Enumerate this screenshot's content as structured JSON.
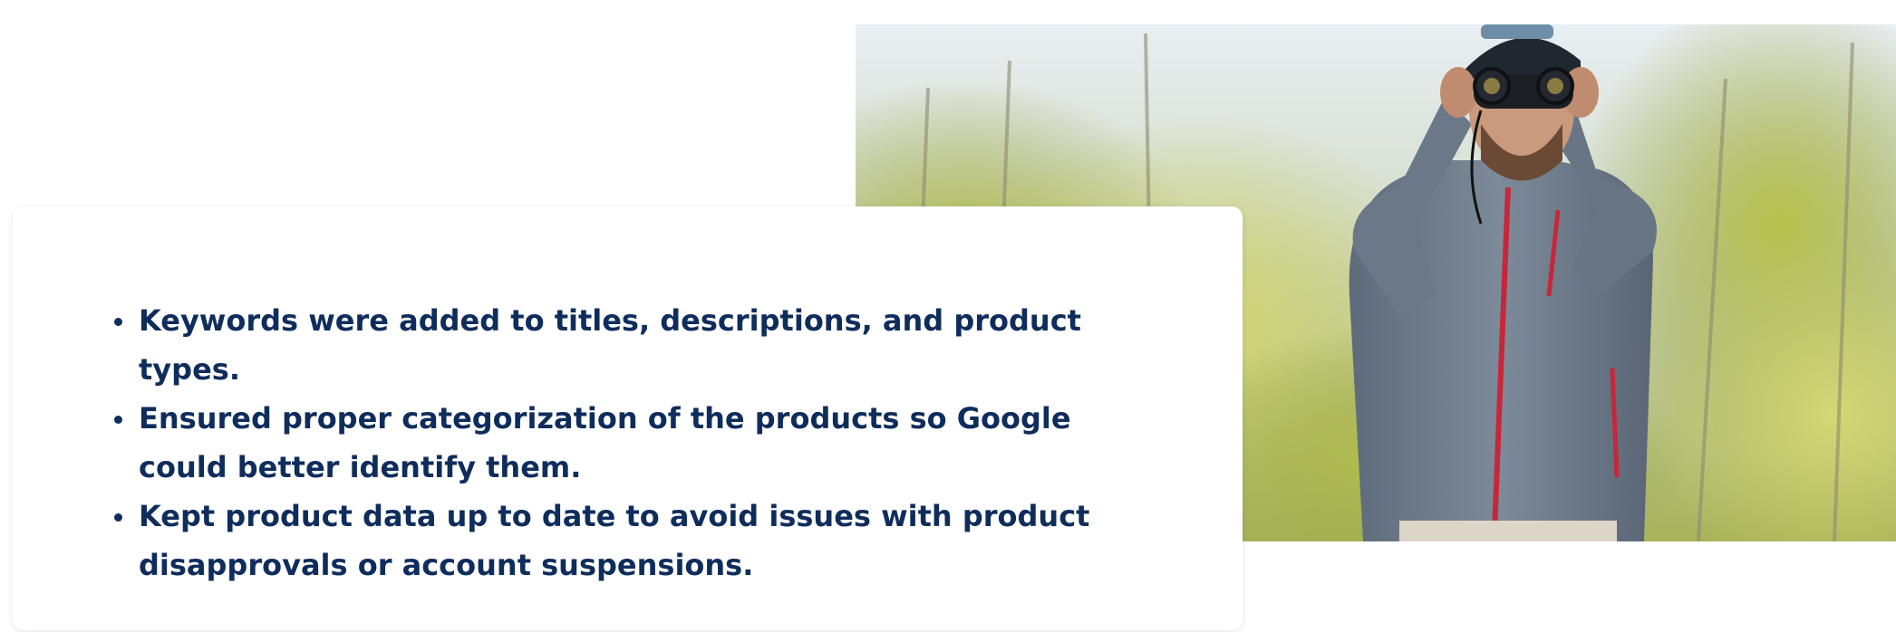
{
  "content": {
    "bullets": [
      "Keywords were added to titles, descriptions, and product types.",
      "Ensured proper categorization of the products so Google could better identify them.",
      "Kept product data up to date to avoid issues with product disapprovals or account suspensions."
    ]
  },
  "colors": {
    "text": "#0f2d5c",
    "card_background": "#ffffff",
    "jacket": "#6f7d8d",
    "zipper_accent": "#c8263a"
  },
  "image": {
    "icon": "man-with-binoculars-photo"
  }
}
